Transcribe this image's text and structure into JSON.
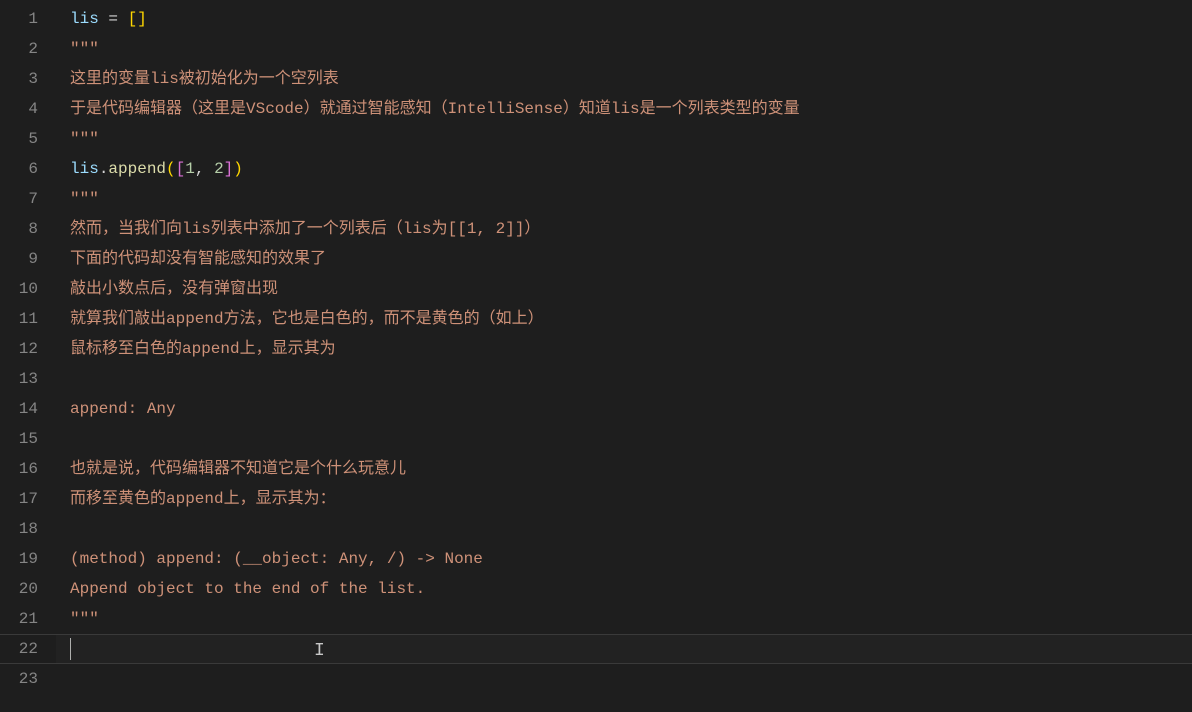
{
  "lineNumbers": [
    "1",
    "2",
    "3",
    "4",
    "5",
    "6",
    "7",
    "8",
    "9",
    "10",
    "11",
    "12",
    "13",
    "14",
    "15",
    "16",
    "17",
    "18",
    "19",
    "20",
    "21",
    "22",
    "23"
  ],
  "code": {
    "l1": {
      "var": "lis",
      "op": " = ",
      "b1": "[",
      "b2": "]"
    },
    "l2": {
      "str": "\"\"\""
    },
    "l3": {
      "str": "这里的变量lis被初始化为一个空列表"
    },
    "l4": {
      "str": "于是代码编辑器（这里是VScode）就通过智能感知（IntelliSense）知道lis是一个列表类型的变量"
    },
    "l5": {
      "str": "\"\"\""
    },
    "l6": {
      "var": "lis",
      "dot": ".",
      "method": "append",
      "p1": "(",
      "b1": "[",
      "n1": "1",
      "comma": ", ",
      "n2": "2",
      "b2": "]",
      "p2": ")"
    },
    "l7": {
      "str": "\"\"\""
    },
    "l8": {
      "str": "然而，当我们向lis列表中添加了一个列表后（lis为[[1, 2]]）"
    },
    "l9": {
      "str": "下面的代码却没有智能感知的效果了"
    },
    "l10": {
      "str": "敲出小数点后，没有弹窗出现"
    },
    "l11": {
      "str": "就算我们敲出append方法，它也是白色的，而不是黄色的（如上）"
    },
    "l12": {
      "str": "鼠标移至白色的append上，显示其为"
    },
    "l13": {
      "str": ""
    },
    "l14": {
      "str": "append: Any"
    },
    "l15": {
      "str": ""
    },
    "l16": {
      "str": "也就是说，代码编辑器不知道它是个什么玩意儿"
    },
    "l17": {
      "str": "而移至黄色的append上，显示其为："
    },
    "l18": {
      "str": ""
    },
    "l19": {
      "str": "(method) append: (__object: Any, /) -> None"
    },
    "l20": {
      "str": "Append object to the end of the list."
    },
    "l21": {
      "str": "\"\"\""
    }
  },
  "textCursorGlyph": "I"
}
